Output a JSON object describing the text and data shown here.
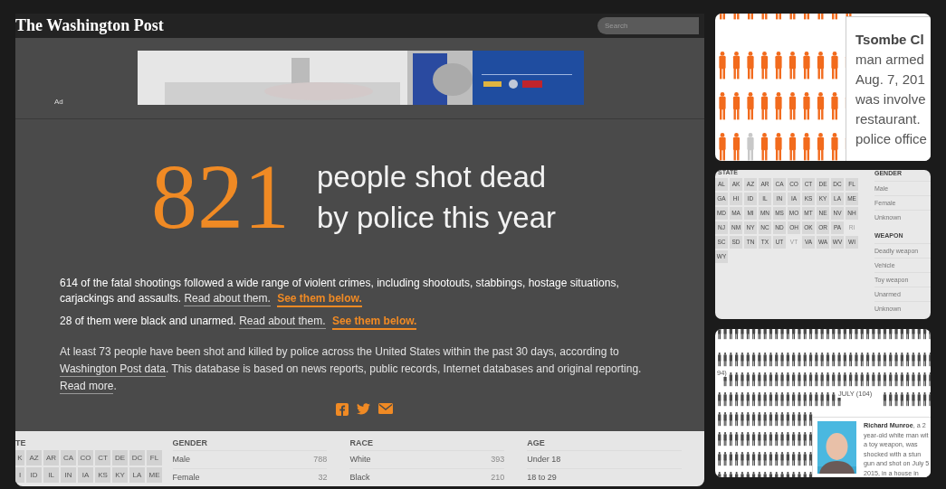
{
  "header": {
    "logo": "The Washington Post",
    "search": {
      "placeholder": "Search"
    }
  },
  "ad": {
    "label": "Ad"
  },
  "headline": {
    "count": "821",
    "lines": [
      "people shot dead",
      "by police this year"
    ]
  },
  "summaries": [
    {
      "parts": [
        {
          "kind": "text",
          "text": "614 of the fatal shootings followed a wide range of violent crimes, including shootouts, stabbings, hostage situations, carjackings and assaults."
        },
        {
          "kind": "link",
          "text": "Read about them."
        },
        {
          "kind": "highlight",
          "text": "See them below."
        }
      ]
    },
    {
      "parts": [
        {
          "kind": "text",
          "text": "28 of them were black and unarmed."
        },
        {
          "kind": "link",
          "text": "Read about them."
        },
        {
          "kind": "highlight",
          "text": "See them below."
        }
      ]
    }
  ],
  "note": {
    "parts": [
      {
        "kind": "text",
        "text": "At least 73 people have been shot and killed by police across the United States within the past 30 days, according to"
      },
      {
        "kind": "link",
        "text": "Washington Post data"
      },
      {
        "kind": "text",
        "text": ". This database is based on news reports, public records, Internet databases and original reporting."
      },
      {
        "kind": "link",
        "text": "Read more"
      },
      {
        "kind": "text",
        "text": "."
      }
    ]
  },
  "filters": [
    {
      "kind": "chips",
      "heading": "TE",
      "rows": [
        [
          {
            "label": "K",
            "disabled": false
          },
          {
            "label": "AZ",
            "disabled": false
          },
          {
            "label": "AR",
            "disabled": false
          },
          {
            "label": "CA",
            "disabled": false
          },
          {
            "label": "CO",
            "disabled": false
          },
          {
            "label": "CT",
            "disabled": false
          },
          {
            "label": "DE",
            "disabled": false
          },
          {
            "label": "DC",
            "disabled": false
          },
          {
            "label": "FL",
            "disabled": false
          }
        ],
        [
          {
            "label": "I",
            "disabled": false
          },
          {
            "label": "ID",
            "disabled": false
          },
          {
            "label": "IL",
            "disabled": false
          },
          {
            "label": "IN",
            "disabled": false
          },
          {
            "label": "IA",
            "disabled": false
          },
          {
            "label": "KS",
            "disabled": false
          },
          {
            "label": "KY",
            "disabled": false
          },
          {
            "label": "LA",
            "disabled": false
          },
          {
            "label": "ME",
            "disabled": false
          }
        ]
      ]
    },
    {
      "kind": "list",
      "heading": "GENDER",
      "items": [
        {
          "label": "Male",
          "count": "788"
        },
        {
          "label": "Female",
          "count": "32"
        }
      ]
    },
    {
      "kind": "list",
      "heading": "RACE",
      "items": [
        {
          "label": "White",
          "count": "393"
        },
        {
          "label": "Black",
          "count": "210"
        }
      ]
    },
    {
      "kind": "list",
      "heading": "AGE",
      "items": [
        {
          "label": "Under 18"
        },
        {
          "label": "18 to 29"
        }
      ]
    }
  ],
  "figures_card": {
    "tooltip": {
      "title": "Tsombe Cl",
      "lines": [
        "man armed",
        "Aug. 7, 201",
        "was involve",
        "restaurant.",
        "police office"
      ]
    }
  },
  "filter_card": {
    "state_heading": "STATE",
    "states": [
      {
        "label": "AL",
        "disabled": false
      },
      {
        "label": "AK",
        "disabled": false
      },
      {
        "label": "AZ",
        "disabled": false
      },
      {
        "label": "AR",
        "disabled": false
      },
      {
        "label": "CA",
        "disabled": false
      },
      {
        "label": "CO",
        "disabled": false
      },
      {
        "label": "CT",
        "disabled": false
      },
      {
        "label": "DE",
        "disabled": false
      },
      {
        "label": "DC",
        "disabled": false
      },
      {
        "label": "FL",
        "disabled": false
      },
      {
        "label": "GA",
        "disabled": false
      },
      {
        "label": "HI",
        "disabled": false
      },
      {
        "label": "ID",
        "disabled": false
      },
      {
        "label": "IL",
        "disabled": false
      },
      {
        "label": "IN",
        "disabled": false
      },
      {
        "label": "IA",
        "disabled": false
      },
      {
        "label": "KS",
        "disabled": false
      },
      {
        "label": "KY",
        "disabled": false
      },
      {
        "label": "LA",
        "disabled": false
      },
      {
        "label": "ME",
        "disabled": false
      },
      {
        "label": "MD",
        "disabled": false
      },
      {
        "label": "MA",
        "disabled": false
      },
      {
        "label": "MI",
        "disabled": false
      },
      {
        "label": "MN",
        "disabled": false
      },
      {
        "label": "MS",
        "disabled": false
      },
      {
        "label": "MO",
        "disabled": false
      },
      {
        "label": "MT",
        "disabled": false
      },
      {
        "label": "NE",
        "disabled": false
      },
      {
        "label": "NV",
        "disabled": false
      },
      {
        "label": "NH",
        "disabled": false
      },
      {
        "label": "NJ",
        "disabled": false
      },
      {
        "label": "NM",
        "disabled": false
      },
      {
        "label": "NY",
        "disabled": false
      },
      {
        "label": "NC",
        "disabled": false
      },
      {
        "label": "ND",
        "disabled": false
      },
      {
        "label": "OH",
        "disabled": false
      },
      {
        "label": "OK",
        "disabled": false
      },
      {
        "label": "OR",
        "disabled": false
      },
      {
        "label": "PA",
        "disabled": false
      },
      {
        "label": "RI",
        "disabled": true
      },
      {
        "label": "SC",
        "disabled": false
      },
      {
        "label": "SD",
        "disabled": false
      },
      {
        "label": "TN",
        "disabled": false
      },
      {
        "label": "TX",
        "disabled": false
      },
      {
        "label": "UT",
        "disabled": false
      },
      {
        "label": "VT",
        "disabled": true
      },
      {
        "label": "VA",
        "disabled": false
      },
      {
        "label": "WA",
        "disabled": false
      },
      {
        "label": "WV",
        "disabled": false
      },
      {
        "label": "WI",
        "disabled": false
      },
      {
        "label": "WY",
        "disabled": false
      }
    ],
    "groups": [
      {
        "heading": "GENDER",
        "items": [
          "Male",
          "Female",
          "Unknown"
        ]
      },
      {
        "heading": "WEAPON",
        "items": [
          "Deadly weapon",
          "Vehicle",
          "Toy weapon",
          "Unarmed",
          "Unknown"
        ]
      }
    ]
  },
  "people_card": {
    "month_labels": [
      "94)",
      "JULY (104)"
    ],
    "tooltip": {
      "lines": [
        "**Richard Munroe**, a 2",
        "year-old white man wit",
        "a toy weapon, was",
        "shocked with a stun",
        "gun and shot on July 5",
        "2015, in a house in"
      ]
    }
  }
}
